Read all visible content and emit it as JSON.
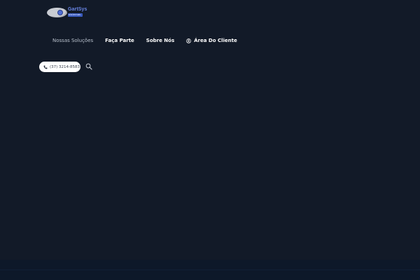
{
  "logo": {
    "brand_text": "GartSys",
    "sub_text": "sistemas"
  },
  "nav": {
    "items": [
      {
        "label": "Nossas Soluções"
      },
      {
        "label": "Faça Parte"
      },
      {
        "label": "Sobre Nós"
      },
      {
        "label": "Área Do Cliente",
        "icon": "user-circle-icon"
      }
    ]
  },
  "contact": {
    "phone": "(37) 3214-8583",
    "phone_icon": "phone-icon",
    "search_icon": "search-icon"
  },
  "colors": {
    "background": "#121a28",
    "footer_band": "#0d1829",
    "nav_muted": "#b8c0cc",
    "nav_active": "#ffffff",
    "pill_bg": "#ffffff",
    "brand_blue": "#4f6fd4"
  }
}
